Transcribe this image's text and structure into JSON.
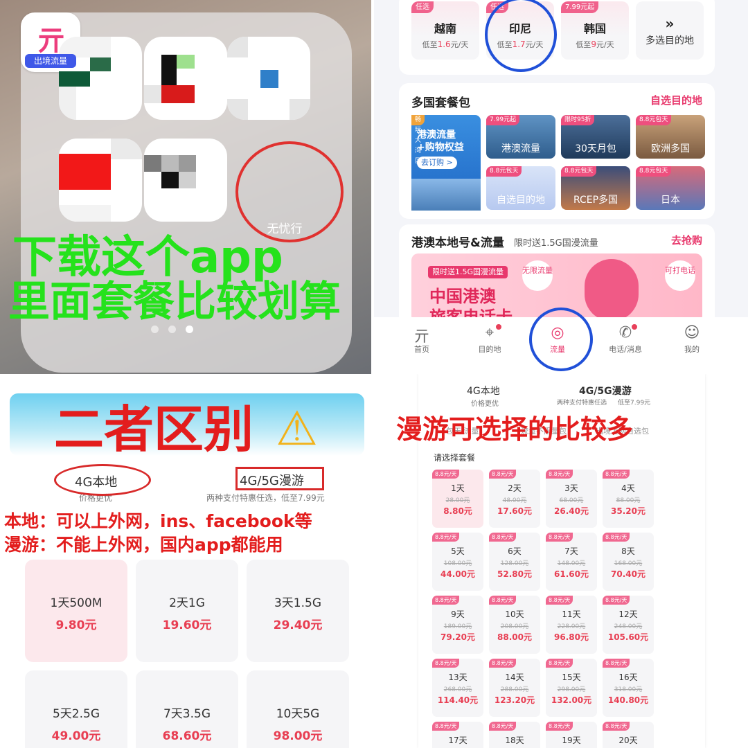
{
  "folder": {
    "app_label": "无忧行",
    "app_tag": "出境流量",
    "app_glyph": "亓",
    "caption_line1": "下载这个app",
    "caption_line2": "里面套餐比较划算"
  },
  "destinations": [
    {
      "badge": "任选",
      "name": "越南",
      "price_prefix": "低至",
      "price": "1.6",
      "price_suffix": "元/天"
    },
    {
      "badge": "任选",
      "name": "印尼",
      "price_prefix": "低至",
      "price": "1.7",
      "price_suffix": "元/天"
    },
    {
      "badge": "7.99元起",
      "name": "韩国",
      "price_prefix": "低至",
      "price": "9",
      "price_suffix": "元/天"
    }
  ],
  "more_destinations": {
    "icon": "»",
    "label": "多选目的地"
  },
  "multi_country": {
    "title": "多国套餐包",
    "link": "自选目的地",
    "promo": {
      "badge": "畅玩大湾区",
      "line1": "港澳流量",
      "line2": "+购物权益",
      "cta": "去订购 >"
    },
    "packages": [
      {
        "badge": "7.99元起",
        "label": "港澳流量"
      },
      {
        "badge": "限时95折",
        "label": "30天月包"
      },
      {
        "badge": "8.8元包天",
        "label": "欧洲多国"
      },
      {
        "badge": "8.8元包天",
        "label": "自选目的地"
      },
      {
        "badge": "8.8元包天",
        "label": "RCEP多国"
      },
      {
        "badge": "8.8元包天",
        "label": "日本"
      }
    ]
  },
  "hk_macau": {
    "title": "港澳本地号&流量",
    "subtitle": "限时送1.5G国漫流量",
    "link": "去抢购",
    "banner_tag": "限时送1.5G国漫流量",
    "banner_title": "中国港澳",
    "banner_title2": "旅客电话卡",
    "bubble_left": "无限流量",
    "bubble_right": "可打电话"
  },
  "tabbar": [
    {
      "icon": "亓",
      "label": "首页"
    },
    {
      "icon": "⌖",
      "label": "目的地"
    },
    {
      "icon": "◎",
      "label": "流量"
    },
    {
      "icon": "✆",
      "label": "电话/消息"
    },
    {
      "icon": "☺",
      "label": "我的"
    }
  ],
  "comparison": {
    "heading": "二者区别",
    "warning": "⚠",
    "tab_local": "4G本地",
    "tab_local_sub": "价格更优",
    "tab_roam": "4G/5G漫游",
    "tab_roam_sub": "两种支付特惠任选，低至7.99元",
    "note_local": "本地：可以上外网，ins、facebook等",
    "note_roam": "漫游：不能上外网，国内app都能用"
  },
  "local_plans": [
    {
      "name": "1天500M",
      "price": "9.80元"
    },
    {
      "name": "2天1G",
      "price": "19.60元"
    },
    {
      "name": "3天1.5G",
      "price": "29.40元"
    },
    {
      "name": "5天2.5G",
      "price": "49.00元"
    },
    {
      "name": "7天3.5G",
      "price": "68.60元"
    },
    {
      "name": "10天5G",
      "price": "98.00元"
    }
  ],
  "roaming": {
    "tab_local": "4G本地",
    "tab_local_sub": "价格更优",
    "tab_roam": "4G/5G漫游",
    "tab_roam_sub1": "两种支付特惠任选",
    "tab_roam_sub2": "低至7.99元",
    "caption": "漫游可选择的比较多",
    "subtabs": [
      "包天·流量",
      "流量不限量包",
      "出境上网自选包"
    ],
    "choose_label": "请选择套餐",
    "badge": "8.8元/天",
    "cells": [
      {
        "day": "1天",
        "orig": "28.00元",
        "price": "8.80元"
      },
      {
        "day": "2天",
        "orig": "48.00元",
        "price": "17.60元"
      },
      {
        "day": "3天",
        "orig": "68.00元",
        "price": "26.40元"
      },
      {
        "day": "4天",
        "orig": "88.00元",
        "price": "35.20元"
      },
      {
        "day": "5天",
        "orig": "108.00元",
        "price": "44.00元"
      },
      {
        "day": "6天",
        "orig": "128.00元",
        "price": "52.80元"
      },
      {
        "day": "7天",
        "orig": "148.00元",
        "price": "61.60元"
      },
      {
        "day": "8天",
        "orig": "168.00元",
        "price": "70.40元"
      },
      {
        "day": "9天",
        "orig": "189.00元",
        "price": "79.20元"
      },
      {
        "day": "10天",
        "orig": "208.00元",
        "price": "88.00元"
      },
      {
        "day": "11天",
        "orig": "228.00元",
        "price": "96.80元"
      },
      {
        "day": "12天",
        "orig": "248.00元",
        "price": "105.60元"
      },
      {
        "day": "13天",
        "orig": "268.00元",
        "price": "114.40元"
      },
      {
        "day": "14天",
        "orig": "288.00元",
        "price": "123.20元"
      },
      {
        "day": "15天",
        "orig": "298.00元",
        "price": "132.00元"
      },
      {
        "day": "16天",
        "orig": "318.00元",
        "price": "140.80元"
      },
      {
        "day": "17天",
        "orig": "",
        "price": ""
      },
      {
        "day": "18天",
        "orig": "",
        "price": ""
      },
      {
        "day": "19天",
        "orig": "",
        "price": ""
      },
      {
        "day": "20天",
        "orig": "",
        "price": ""
      }
    ]
  }
}
